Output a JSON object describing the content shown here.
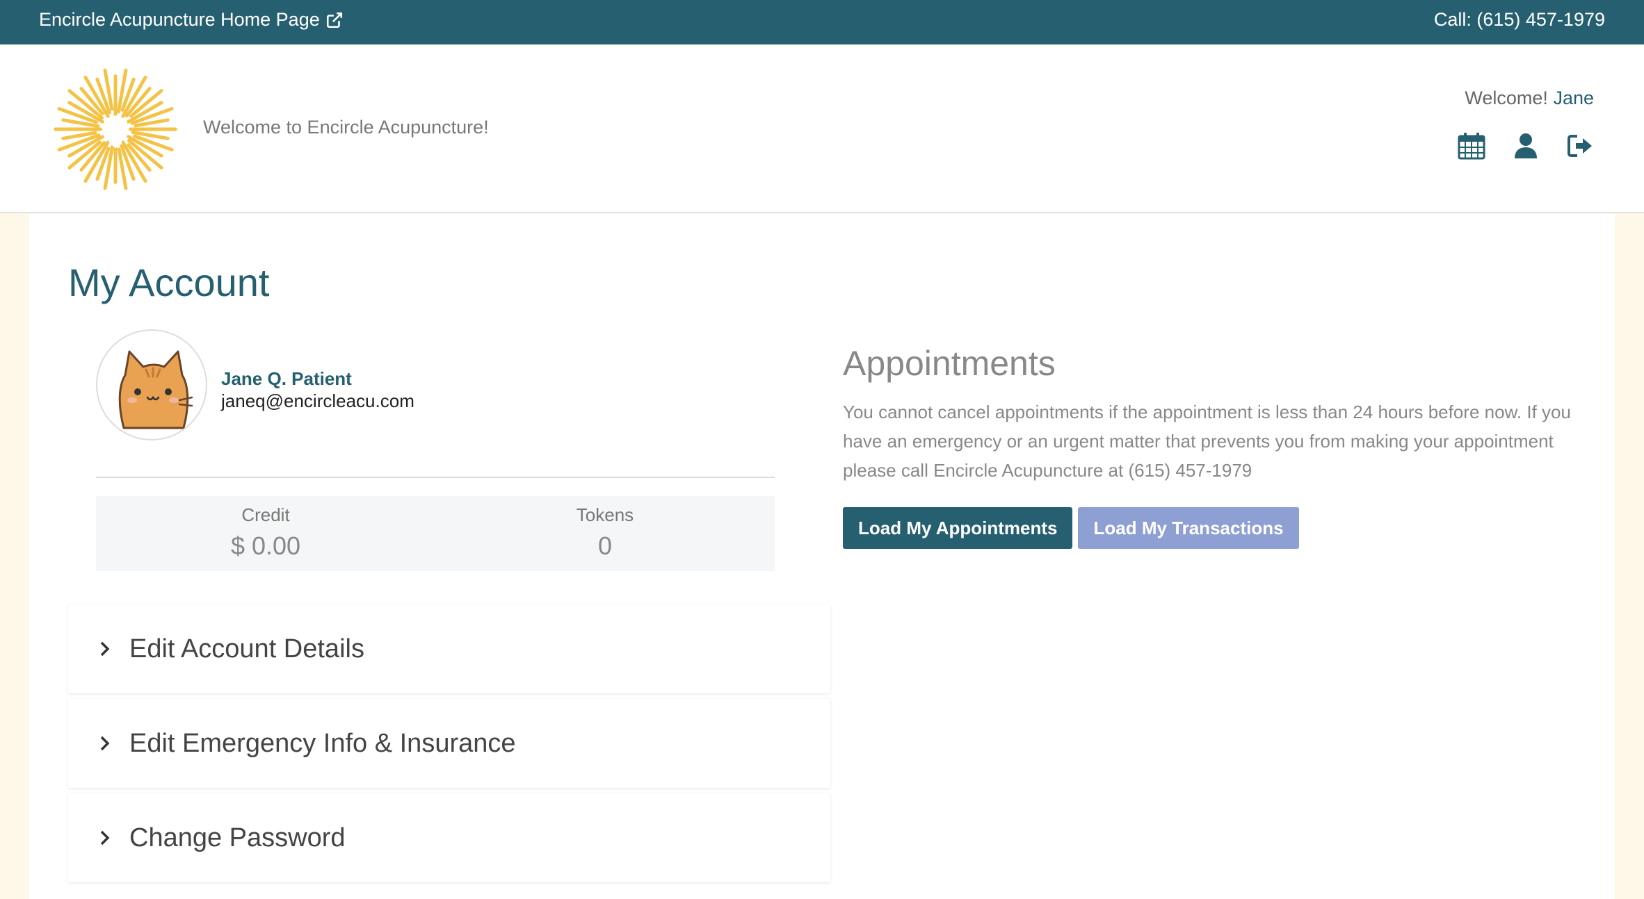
{
  "topbar": {
    "home_link": "Encircle Acupuncture Home Page",
    "phone": "Call: (615) 457-1979"
  },
  "header": {
    "welcome_text": "Welcome to Encircle Acupuncture!",
    "user_greeting": "Welcome!",
    "user_name": "Jane",
    "icons": [
      "calendar-icon",
      "user-icon",
      "sign-out-icon"
    ]
  },
  "colors": {
    "brand": "#255f70",
    "logo": "#f4c244",
    "secondary_button": "#8d9fd3",
    "page_background": "#fdf8e8"
  },
  "page": {
    "title": "My Account"
  },
  "profile": {
    "name": "Jane Q. Patient",
    "email": "janeq@encircleacu.com"
  },
  "stats": {
    "credit_label": "Credit",
    "credit_value": "$ 0.00",
    "tokens_label": "Tokens",
    "tokens_value": "0"
  },
  "accordion": [
    {
      "label": "Edit Account Details"
    },
    {
      "label": "Edit Emergency Info & Insurance"
    },
    {
      "label": "Change Password"
    }
  ],
  "appointments": {
    "title": "Appointments",
    "note": "You cannot cancel appointments if the appointment is less than 24 hours before now. If you have an emergency or an urgent matter that prevents you from making your appointment please call Encircle Acupuncture at (615) 457-1979",
    "load_appointments": "Load My Appointments",
    "load_transactions": "Load My Transactions"
  }
}
